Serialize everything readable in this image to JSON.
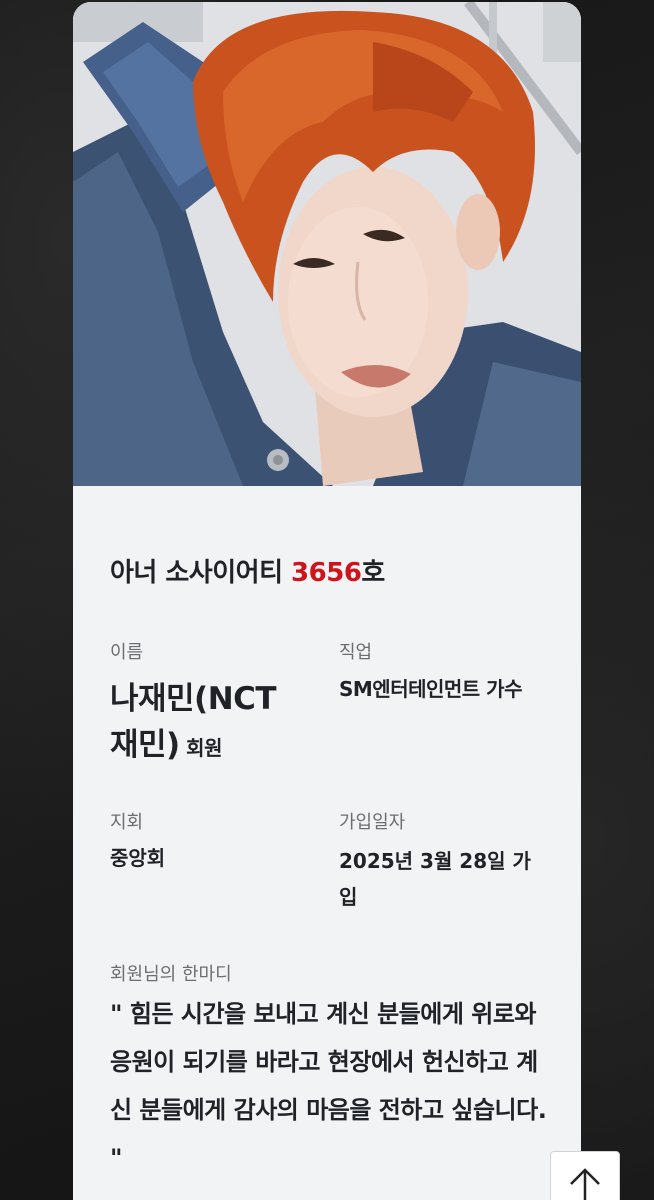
{
  "society": {
    "title_prefix": "아너 소사이어티 ",
    "number": "3656",
    "title_suffix": "호"
  },
  "fields": {
    "name_label": "이름",
    "name_value": "나재민(NCT 재민)",
    "name_suffix": " 회원",
    "job_label": "직업",
    "job_value": "SM엔터테인먼트 가수",
    "branch_label": "지회",
    "branch_value": "중앙회",
    "date_label": "가입일자",
    "date_value": "2025년 3월 28일 가입"
  },
  "quote": {
    "label": "회원님의 한마디",
    "text": "\" 힘든 시간을 보내고 계신 분들에게 위로와 응원이 되기를 바라고 현장에서 헌신하고 계신 분들에게 감사의 마음을 전하고 싶습니다. \""
  },
  "icons": {
    "scroll_top": "arrow-up-icon"
  },
  "colors": {
    "accent": "#d0121b",
    "card_bg": "#f2f3f5",
    "text": "#1f2227",
    "label": "#6b6e73"
  }
}
